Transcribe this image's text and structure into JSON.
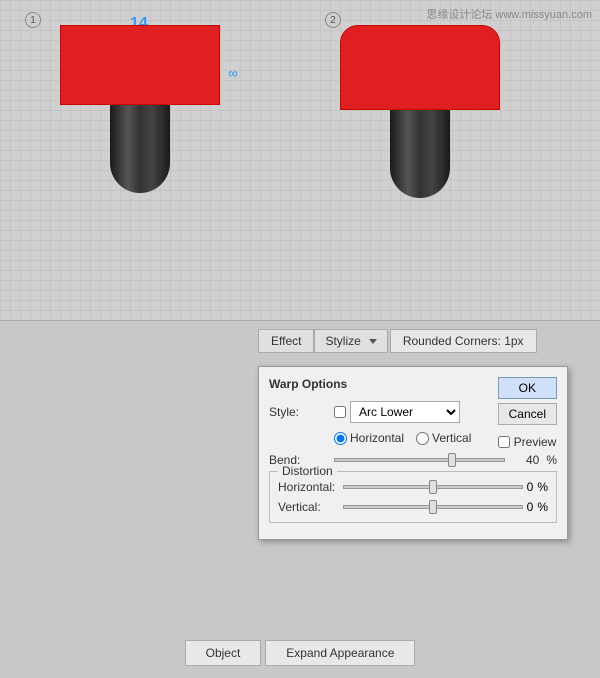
{
  "watermark": {
    "text": "思缘设计论坛 www.missyuan.com"
  },
  "canvas": {
    "label1": "1",
    "label2": "2",
    "num_label": "14"
  },
  "toolbar": {
    "effect_label": "Effect",
    "stylize_label": "Stylize",
    "rounded_corners_label": "Rounded Corners: 1px"
  },
  "warp_dialog": {
    "title": "Warp Options",
    "style_label": "Style:",
    "style_value": "Arc Lower",
    "horizontal_label": "Horizontal",
    "vertical_label": "Vertical",
    "bend_label": "Bend:",
    "bend_value": "40",
    "bend_percent": "%",
    "distortion_label": "Distortion",
    "horizontal_dist_label": "Horizontal:",
    "horizontal_dist_value": "0",
    "horizontal_dist_percent": "%",
    "vertical_dist_label": "Vertical:",
    "vertical_dist_value": "0",
    "vertical_dist_percent": "%",
    "ok_label": "OK",
    "cancel_label": "Cancel",
    "preview_label": "Preview"
  },
  "bottom_buttons": {
    "object_label": "Object",
    "expand_label": "Expand Appearance"
  }
}
